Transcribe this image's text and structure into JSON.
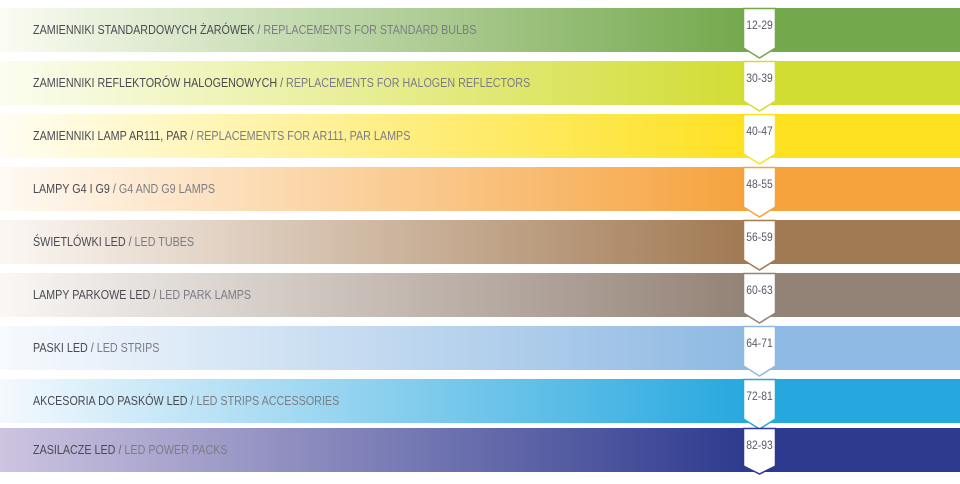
{
  "rows": [
    {
      "pl": "ZAMIENNIKI STANDARDOWYCH ŻARÓWEK",
      "en": "REPLACEMENTS FOR STANDARD BULBS",
      "pages": "12-29",
      "color_start": "#fbfcf3",
      "color_end": "#73a84c"
    },
    {
      "pl": "ZAMIENNIKI REFLEKTORÓW HALOGENOWYCH",
      "en": "REPLACEMENTS FOR HALOGEN REFLECTORS",
      "pages": "30-39",
      "color_start": "#fbfdf0",
      "color_end": "#d2dd33"
    },
    {
      "pl": "ZAMIENNIKI LAMP AR111, PAR",
      "en": "REPLACEMENTS FOR AR111, PAR LAMPS",
      "pages": "40-47",
      "color_start": "#fffdf2",
      "color_end": "#fee121"
    },
    {
      "pl": "LAMPY G4 I G9",
      "en": "G4 AND G9 LAMPS",
      "pages": "48-55",
      "color_start": "#fffaf3",
      "color_end": "#f6a23d"
    },
    {
      "pl": "ŚWIETLÓWKI LED",
      "en": "LED TUBES",
      "pages": "56-59",
      "color_start": "#fcf7f3",
      "color_end": "#a17952"
    },
    {
      "pl": "LAMPY PARKOWE LED",
      "en": "LED PARK LAMPS",
      "pages": "60-63",
      "color_start": "#faf7f5",
      "color_end": "#938276"
    },
    {
      "pl": "PASKI LED",
      "en": "LED STRIPS",
      "pages": "64-71",
      "color_start": "#f7fafe",
      "color_end": "#8eb9e2"
    },
    {
      "pl": "AKCESORIA DO PASKÓW LED",
      "en": "LED STRIPS ACCESSORIES",
      "pages": "72-81",
      "color_start": "#f4f9fe",
      "color_end": "#26a8df"
    },
    {
      "pl": "ZASILACZE LED",
      "en": "LED POWER PACKS",
      "pages": "82-93",
      "color_start": "#cdc4e0",
      "color_end": "#2d3a8e"
    }
  ],
  "separator": " / "
}
